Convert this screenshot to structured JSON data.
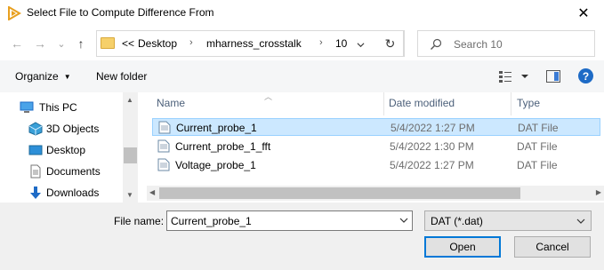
{
  "window": {
    "title": "Select File to Compute Difference From",
    "close_label": "✕"
  },
  "nav": {
    "back_glyph": "←",
    "forward_glyph": "→",
    "recent_glyph": "⌄",
    "up_glyph": "↑",
    "breadcrumb_overflow": "<<",
    "breadcrumbs": [
      "Desktop",
      "mharness_crosstalk",
      "10"
    ],
    "breadcrumb_sep": "›",
    "refresh_glyph": "↻",
    "search_placeholder": "Search 10"
  },
  "toolbar": {
    "organize_label": "Organize",
    "new_folder_label": "New folder",
    "help_label": "?"
  },
  "sidebar": {
    "items": [
      {
        "label": "This PC",
        "icon": "pc-icon"
      },
      {
        "label": "3D Objects",
        "icon": "3d-objects-icon"
      },
      {
        "label": "Desktop",
        "icon": "desktop-icon"
      },
      {
        "label": "Documents",
        "icon": "documents-icon"
      },
      {
        "label": "Downloads",
        "icon": "downloads-icon"
      }
    ]
  },
  "list": {
    "columns": [
      "Name",
      "Date modified",
      "Type"
    ],
    "rows": [
      {
        "name": "Current_probe_1",
        "date": "5/4/2022 1:27 PM",
        "type": "DAT File",
        "selected": true
      },
      {
        "name": "Current_probe_1_fft",
        "date": "5/4/2022 1:30 PM",
        "type": "DAT File",
        "selected": false
      },
      {
        "name": "Voltage_probe_1",
        "date": "5/4/2022 1:27 PM",
        "type": "DAT File",
        "selected": false
      }
    ]
  },
  "footer": {
    "file_name_label": "File name:",
    "file_name_value": "Current_probe_1",
    "file_type_value": "DAT (*.dat)",
    "open_label": "Open",
    "cancel_label": "Cancel"
  },
  "colors": {
    "selection_bg": "#cce8ff",
    "selection_border": "#99d1ff",
    "accent": "#0078d7",
    "header_text": "#4c607a"
  }
}
